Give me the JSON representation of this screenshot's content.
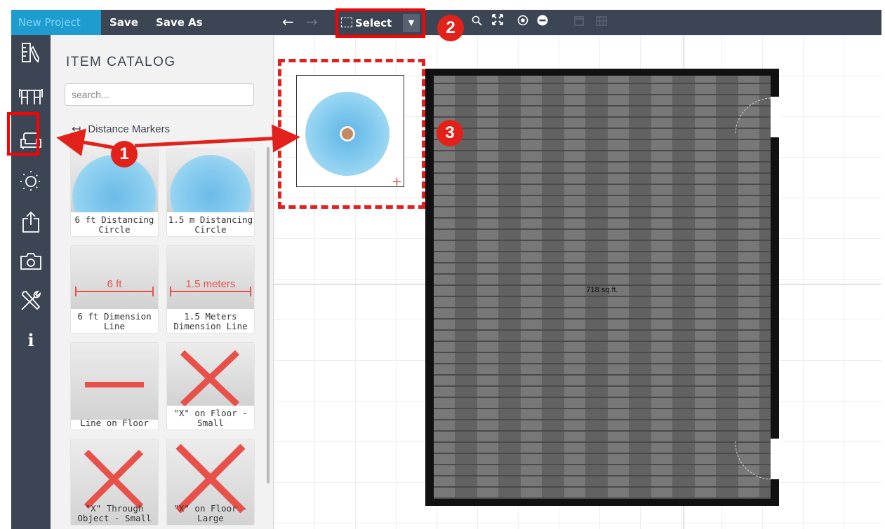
{
  "toolbar": {
    "new_project": "New Project",
    "save": "Save",
    "save_as": "Save As",
    "select_label": "Select"
  },
  "catalog": {
    "title": "ITEM CATALOG",
    "search_placeholder": "search...",
    "back_label": "Distance Markers",
    "items": [
      {
        "label": "6 ft Distancing Circle"
      },
      {
        "label": "1.5 m Distancing Circle"
      },
      {
        "label": "6 ft Dimension Line",
        "thumb_text": "6 ft"
      },
      {
        "label": "1.5 Meters Dimension Line",
        "thumb_text": "1.5 meters"
      },
      {
        "label": "Line on Floor"
      },
      {
        "label": "\"X\" on Floor - Small"
      },
      {
        "label": "\"X\" Through Object - Small"
      },
      {
        "label": "\"X\" on Floor - Large"
      }
    ]
  },
  "canvas": {
    "area_label": "718 sq.ft."
  },
  "annotations": {
    "badge_1": "1",
    "badge_2": "2",
    "badge_3": "3"
  },
  "colors": {
    "toolbar_bg": "#3c4553",
    "new_project_bg": "#1e9ccf",
    "annotation_red": "#e3211b",
    "marker_red": "#e8514a"
  }
}
